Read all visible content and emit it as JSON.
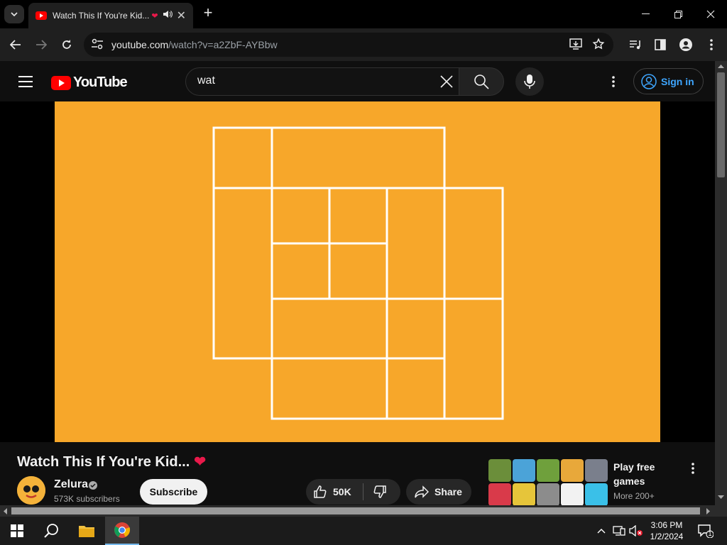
{
  "browser": {
    "tab_title": "Watch This If You're Kid...",
    "tab_heart": "❤",
    "url_host": "youtube.com",
    "url_path": "/watch?v=a2ZbF-AYBbw"
  },
  "header": {
    "logo_text": "YouTube",
    "search_value": "wat",
    "signin_label": "Sign in"
  },
  "video": {
    "background_color": "#f7a72a",
    "line_color": "#ffffff",
    "title": "Watch This If You're Kid...",
    "title_heart": "❤"
  },
  "channel": {
    "name": "Zelura",
    "subscribers": "573K subscribers",
    "subscribe_label": "Subscribe"
  },
  "actions": {
    "likes": "50K",
    "share_label": "Share"
  },
  "sidebar_ad": {
    "title": "Play free games",
    "subtitle": "More 200+",
    "tile_colors": [
      "#6b8e3a",
      "#4ba3d8",
      "#6fa03c",
      "#e8a83a",
      "#7a7f8c",
      "#d93a4a",
      "#e6c53a",
      "#8c8c8c",
      "#f2f2f2",
      "#3ac0e8"
    ]
  },
  "taskbar": {
    "time": "3:06 PM",
    "date": "1/2/2024",
    "notification_count": "1"
  }
}
